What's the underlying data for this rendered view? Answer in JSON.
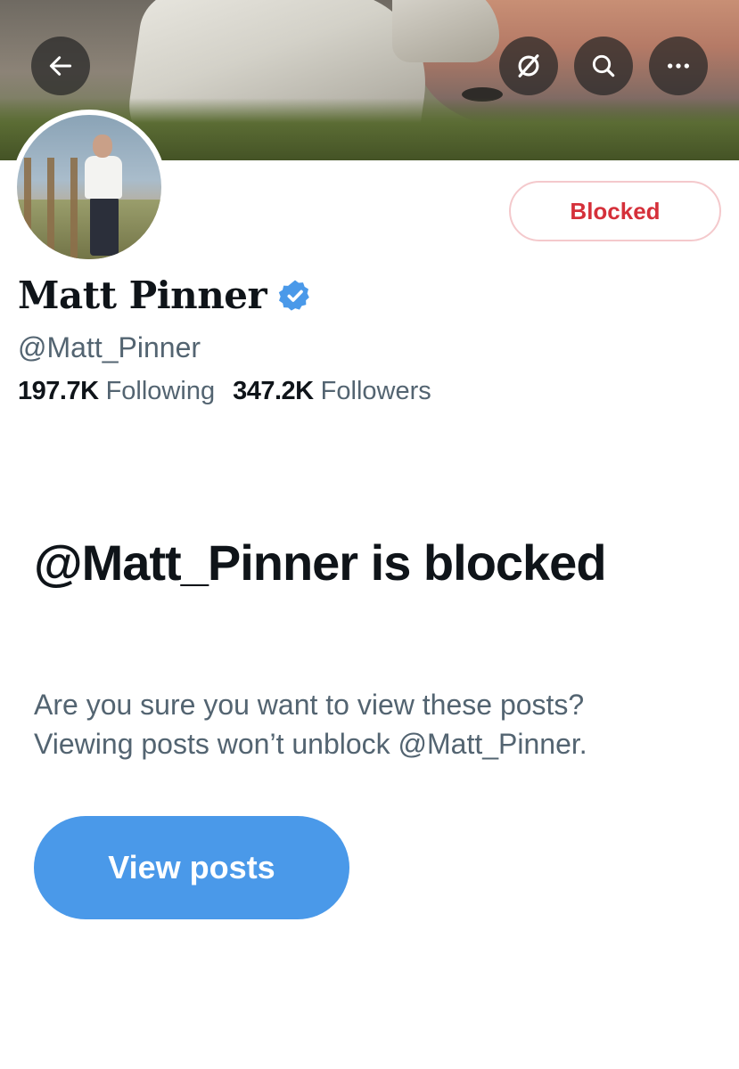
{
  "header": {
    "back_icon": "arrow-left-icon",
    "actions": [
      {
        "name": "slash-circle-icon"
      },
      {
        "name": "search-icon"
      },
      {
        "name": "more-icon"
      }
    ]
  },
  "profile": {
    "display_name": "Matt Pinner",
    "verified": true,
    "verified_color": "#4a99e9",
    "handle": "@Matt_Pinner",
    "following_count": "197.7K",
    "following_label": "Following",
    "followers_count": "347.2K",
    "followers_label": "Followers",
    "block_button_label": "Blocked",
    "block_button_color": "#d5303a"
  },
  "blocked_notice": {
    "title": "@Matt_Pinner is blocked",
    "description_line1": "Are you sure you want to view these posts?",
    "description_line2": "Viewing posts won’t unblock @Matt_Pinner.",
    "view_button_label": "View posts",
    "view_button_color": "#4a99e9"
  }
}
